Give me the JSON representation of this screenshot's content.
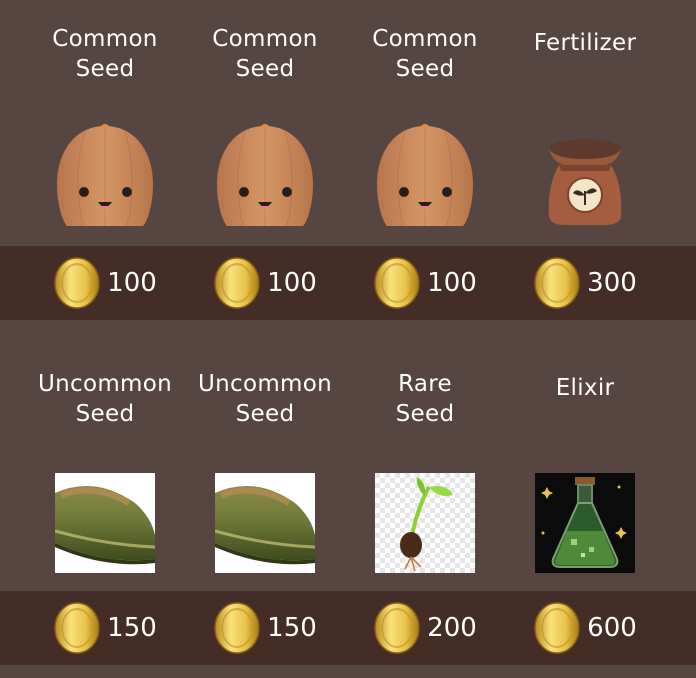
{
  "shop": {
    "rows": [
      {
        "items": [
          {
            "name_line1": "Common",
            "name_line2": "Seed",
            "icon": "common-seed-icon",
            "price": "100"
          },
          {
            "name_line1": "Common",
            "name_line2": "Seed",
            "icon": "common-seed-icon",
            "price": "100"
          },
          {
            "name_line1": "Common",
            "name_line2": "Seed",
            "icon": "common-seed-icon",
            "price": "100"
          },
          {
            "name_line1": "Fertilizer",
            "name_line2": "",
            "icon": "fertilizer-bag-icon",
            "price": "300"
          }
        ]
      },
      {
        "items": [
          {
            "name_line1": "Uncommon",
            "name_line2": "Seed",
            "icon": "uncommon-seed-icon",
            "price": "150"
          },
          {
            "name_line1": "Uncommon",
            "name_line2": "Seed",
            "icon": "uncommon-seed-icon",
            "price": "150"
          },
          {
            "name_line1": "Rare",
            "name_line2": "Seed",
            "icon": "rare-seed-sprout-icon",
            "price": "200"
          },
          {
            "name_line1": "Elixir",
            "name_line2": "",
            "icon": "elixir-flask-icon",
            "price": "600"
          }
        ]
      }
    ],
    "currency_icon": "gold-coin-icon"
  },
  "colors": {
    "background": "#574542",
    "price_band": "#432d26",
    "coin_gold": "#e8c24a",
    "seed_brown": "#c98a5a",
    "uncommon_green": "#6f7a38"
  }
}
